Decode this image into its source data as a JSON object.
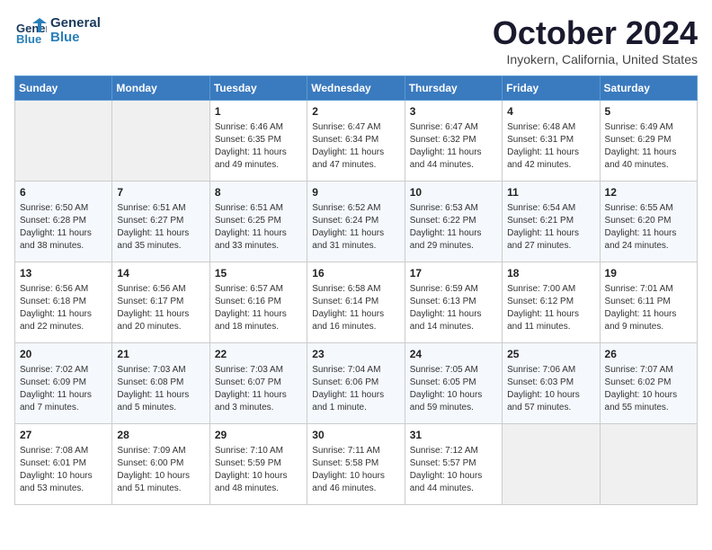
{
  "header": {
    "logo": {
      "line1": "General",
      "line2": "Blue"
    },
    "title": "October 2024",
    "location": "Inyokern, California, United States"
  },
  "weekdays": [
    "Sunday",
    "Monday",
    "Tuesday",
    "Wednesday",
    "Thursday",
    "Friday",
    "Saturday"
  ],
  "weeks": [
    [
      {
        "day": "",
        "info": ""
      },
      {
        "day": "",
        "info": ""
      },
      {
        "day": "1",
        "info": "Sunrise: 6:46 AM\nSunset: 6:35 PM\nDaylight: 11 hours and 49 minutes."
      },
      {
        "day": "2",
        "info": "Sunrise: 6:47 AM\nSunset: 6:34 PM\nDaylight: 11 hours and 47 minutes."
      },
      {
        "day": "3",
        "info": "Sunrise: 6:47 AM\nSunset: 6:32 PM\nDaylight: 11 hours and 44 minutes."
      },
      {
        "day": "4",
        "info": "Sunrise: 6:48 AM\nSunset: 6:31 PM\nDaylight: 11 hours and 42 minutes."
      },
      {
        "day": "5",
        "info": "Sunrise: 6:49 AM\nSunset: 6:29 PM\nDaylight: 11 hours and 40 minutes."
      }
    ],
    [
      {
        "day": "6",
        "info": "Sunrise: 6:50 AM\nSunset: 6:28 PM\nDaylight: 11 hours and 38 minutes."
      },
      {
        "day": "7",
        "info": "Sunrise: 6:51 AM\nSunset: 6:27 PM\nDaylight: 11 hours and 35 minutes."
      },
      {
        "day": "8",
        "info": "Sunrise: 6:51 AM\nSunset: 6:25 PM\nDaylight: 11 hours and 33 minutes."
      },
      {
        "day": "9",
        "info": "Sunrise: 6:52 AM\nSunset: 6:24 PM\nDaylight: 11 hours and 31 minutes."
      },
      {
        "day": "10",
        "info": "Sunrise: 6:53 AM\nSunset: 6:22 PM\nDaylight: 11 hours and 29 minutes."
      },
      {
        "day": "11",
        "info": "Sunrise: 6:54 AM\nSunset: 6:21 PM\nDaylight: 11 hours and 27 minutes."
      },
      {
        "day": "12",
        "info": "Sunrise: 6:55 AM\nSunset: 6:20 PM\nDaylight: 11 hours and 24 minutes."
      }
    ],
    [
      {
        "day": "13",
        "info": "Sunrise: 6:56 AM\nSunset: 6:18 PM\nDaylight: 11 hours and 22 minutes."
      },
      {
        "day": "14",
        "info": "Sunrise: 6:56 AM\nSunset: 6:17 PM\nDaylight: 11 hours and 20 minutes."
      },
      {
        "day": "15",
        "info": "Sunrise: 6:57 AM\nSunset: 6:16 PM\nDaylight: 11 hours and 18 minutes."
      },
      {
        "day": "16",
        "info": "Sunrise: 6:58 AM\nSunset: 6:14 PM\nDaylight: 11 hours and 16 minutes."
      },
      {
        "day": "17",
        "info": "Sunrise: 6:59 AM\nSunset: 6:13 PM\nDaylight: 11 hours and 14 minutes."
      },
      {
        "day": "18",
        "info": "Sunrise: 7:00 AM\nSunset: 6:12 PM\nDaylight: 11 hours and 11 minutes."
      },
      {
        "day": "19",
        "info": "Sunrise: 7:01 AM\nSunset: 6:11 PM\nDaylight: 11 hours and 9 minutes."
      }
    ],
    [
      {
        "day": "20",
        "info": "Sunrise: 7:02 AM\nSunset: 6:09 PM\nDaylight: 11 hours and 7 minutes."
      },
      {
        "day": "21",
        "info": "Sunrise: 7:03 AM\nSunset: 6:08 PM\nDaylight: 11 hours and 5 minutes."
      },
      {
        "day": "22",
        "info": "Sunrise: 7:03 AM\nSunset: 6:07 PM\nDaylight: 11 hours and 3 minutes."
      },
      {
        "day": "23",
        "info": "Sunrise: 7:04 AM\nSunset: 6:06 PM\nDaylight: 11 hours and 1 minute."
      },
      {
        "day": "24",
        "info": "Sunrise: 7:05 AM\nSunset: 6:05 PM\nDaylight: 10 hours and 59 minutes."
      },
      {
        "day": "25",
        "info": "Sunrise: 7:06 AM\nSunset: 6:03 PM\nDaylight: 10 hours and 57 minutes."
      },
      {
        "day": "26",
        "info": "Sunrise: 7:07 AM\nSunset: 6:02 PM\nDaylight: 10 hours and 55 minutes."
      }
    ],
    [
      {
        "day": "27",
        "info": "Sunrise: 7:08 AM\nSunset: 6:01 PM\nDaylight: 10 hours and 53 minutes."
      },
      {
        "day": "28",
        "info": "Sunrise: 7:09 AM\nSunset: 6:00 PM\nDaylight: 10 hours and 51 minutes."
      },
      {
        "day": "29",
        "info": "Sunrise: 7:10 AM\nSunset: 5:59 PM\nDaylight: 10 hours and 48 minutes."
      },
      {
        "day": "30",
        "info": "Sunrise: 7:11 AM\nSunset: 5:58 PM\nDaylight: 10 hours and 46 minutes."
      },
      {
        "day": "31",
        "info": "Sunrise: 7:12 AM\nSunset: 5:57 PM\nDaylight: 10 hours and 44 minutes."
      },
      {
        "day": "",
        "info": ""
      },
      {
        "day": "",
        "info": ""
      }
    ]
  ]
}
